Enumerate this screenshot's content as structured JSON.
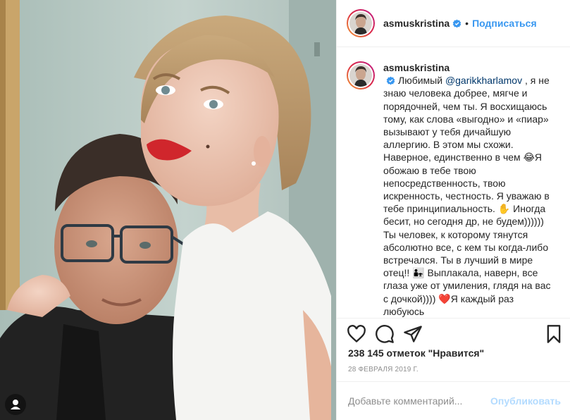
{
  "post": {
    "username": "asmuskristina",
    "follow_label": "Подписаться",
    "separator": "•",
    "caption": {
      "username": "asmuskristina",
      "lead": "Любимый",
      "mention": "@garikkharlamov",
      "body": " , я не знаю человека добрее, мягче и порядочней, чем ты. Я восхищаюсь тому, как слова «выгодно» и «пиар» вызывают у тебя дичайшую аллергию. В этом мы схожи. Наверное, единственно в чем 😂Я обожаю в тебе твою непосредственность, твою искренность, честность. Я уважаю в тебе принципиальность. ✋ Иногда бесит, но сегодня др, не будем)))))) Ты человек, к которому тянутся абсолютно все, с кем ты когда-либо встречался. Ты в лучший в мире отец!! 👨‍👧 Выплакала, наверн, все глаза уже от умиления, глядя на вас с дочкой)))) ❤️Я каждый раз любуюсь"
    },
    "likes_label": "238 145 отметок \"Нравится\"",
    "date": "28 ФЕВРАЛЯ 2019 Г.",
    "comment": {
      "placeholder": "Добавьте комментарий...",
      "value": "",
      "publish_label": "Опубликовать"
    },
    "icons": {
      "like": "heart-icon",
      "comment": "comment-icon",
      "share": "share-icon",
      "save": "bookmark-icon",
      "verified": "verified-badge-icon",
      "tag": "user-tag-icon"
    },
    "colors": {
      "link": "#3897f0",
      "mention": "#00376b",
      "publish_disabled": "#b3dbff",
      "verified": "#3897f0"
    }
  }
}
